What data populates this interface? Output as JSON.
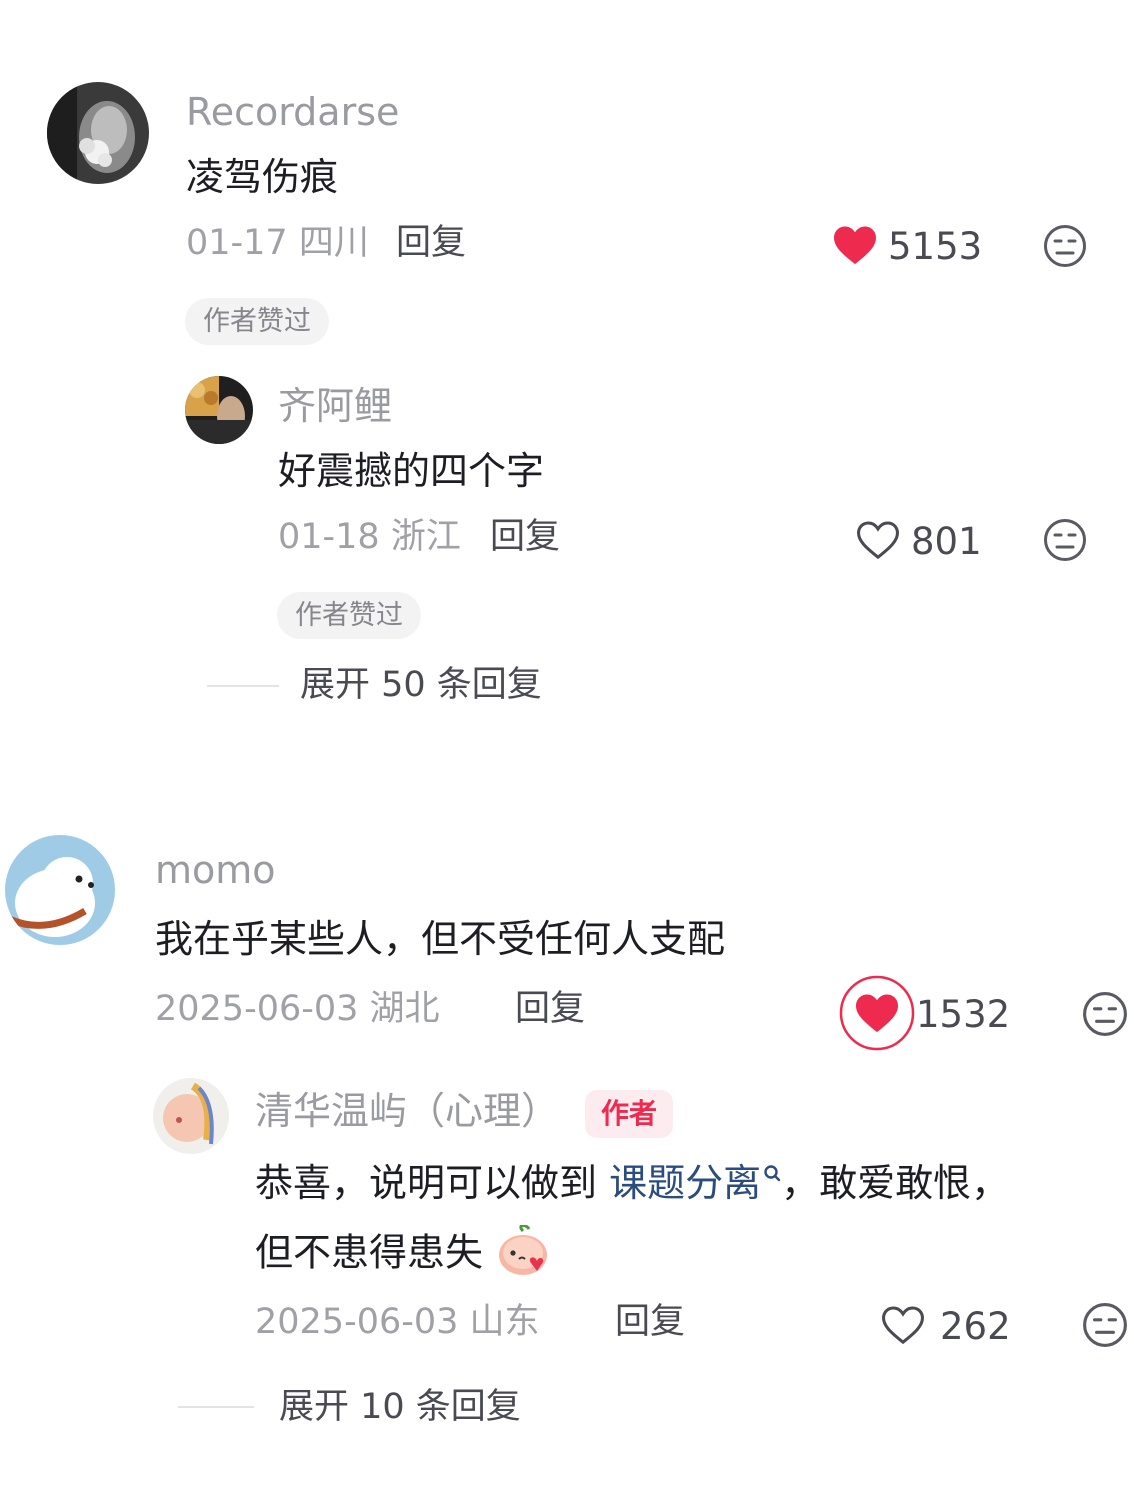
{
  "comments": [
    {
      "username": "Recordarse",
      "text": "凌驾伤痕",
      "date": "01-17",
      "location": "四川",
      "reply_label": "回复",
      "likes": "5153",
      "liked": true,
      "badge": "作者赞过",
      "replies": [
        {
          "username": "齐阿鲤",
          "text": "好震撼的四个字",
          "date": "01-18",
          "location": "浙江",
          "reply_label": "回复",
          "likes": "801",
          "liked": false,
          "badge": "作者赞过"
        }
      ],
      "expand_label": "展开 50 条回复"
    },
    {
      "username": "momo",
      "text": "我在乎某些人，但不受任何人支配",
      "date": "2025-06-03",
      "location": "湖北",
      "reply_label": "回复",
      "likes": "1532",
      "liked": true,
      "replies": [
        {
          "username": "清华温屿（心理）",
          "author_tag": "作者",
          "text_part1": "恭喜，说明可以做到 ",
          "link_text": "课题分离",
          "text_part2": "，敢爱敢恨，",
          "text_line2": "但不患得患失",
          "date": "2025-06-03",
          "location": "山东",
          "reply_label": "回复",
          "likes": "262",
          "liked": false
        }
      ],
      "expand_label": "展开 10 条回复"
    }
  ],
  "colors": {
    "like_red": "#ee2a4f",
    "username_gray": "#9a9ba0",
    "link_blue": "#2b4c7e"
  },
  "icons": {
    "like_filled": "heart-filled-icon",
    "like_outline": "heart-outline-icon",
    "dislike": "meh-face-icon",
    "search": "search-icon",
    "emoji": "peach-blush-emoji"
  }
}
